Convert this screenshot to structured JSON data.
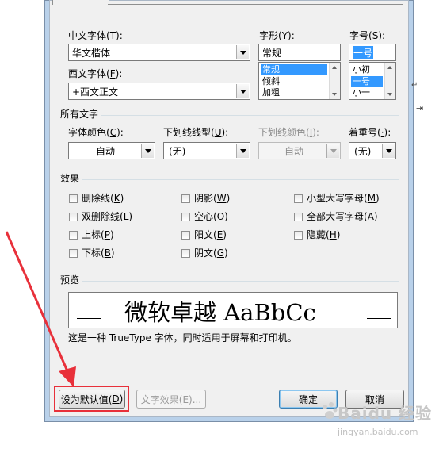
{
  "fonts": {
    "chinese_font_label": "中文字体(",
    "chinese_font_key": "T",
    "chinese_font_value": "华文楷体",
    "western_font_label": "西文字体(",
    "western_font_key": "F",
    "western_font_value": "+西文正文",
    "style_label": "字形(",
    "style_key": "Y",
    "style_value": "常规",
    "style_options": [
      "常规",
      "倾斜",
      "加粗"
    ],
    "size_label": "字号(",
    "size_key": "S",
    "size_value": "一号",
    "size_options": [
      "小初",
      "一号",
      "小一"
    ]
  },
  "all_text": {
    "section_title": "所有文字",
    "color_label": "字体颜色(",
    "color_key": "C",
    "color_value": "自动",
    "underline_label": "下划线线型(",
    "underline_key": "U",
    "underline_value": "(无)",
    "underline_color_label": "下划线颜色(",
    "underline_color_key": "I",
    "underline_color_value": "自动",
    "emphasis_label": "着重号(",
    "emphasis_key": "·",
    "emphasis_value": "(无)"
  },
  "effects": {
    "section_title": "效果",
    "items": [
      {
        "label": "删除线(",
        "key": "K"
      },
      {
        "label": "阴影(",
        "key": "W"
      },
      {
        "label": "小型大写字母(",
        "key": "M"
      },
      {
        "label": "双删除线(",
        "key": "L"
      },
      {
        "label": "空心(",
        "key": "O"
      },
      {
        "label": "全部大写字母(",
        "key": "A"
      },
      {
        "label": "上标(",
        "key": "P"
      },
      {
        "label": "阳文(",
        "key": "E"
      },
      {
        "label": "隐藏(",
        "key": "H"
      },
      {
        "label": "下标(",
        "key": "B"
      },
      {
        "label": "阴文(",
        "key": "G"
      }
    ]
  },
  "preview": {
    "section_title": "预览",
    "sample_text": "微软卓越  AaBbCc",
    "description": "这是一种 TrueType 字体，同时适用于屏幕和打印机。"
  },
  "buttons": {
    "set_default": "设为默认值(",
    "set_default_key": "D",
    "text_effects": "文字效果(E)...",
    "ok": "确定",
    "cancel": "取消"
  },
  "colors": {
    "annotation_red": "#e8303a",
    "selection_blue": "#3399ff"
  },
  "watermark": {
    "brand": "Baidu 经验",
    "url": "jingyan.baidu.com"
  }
}
